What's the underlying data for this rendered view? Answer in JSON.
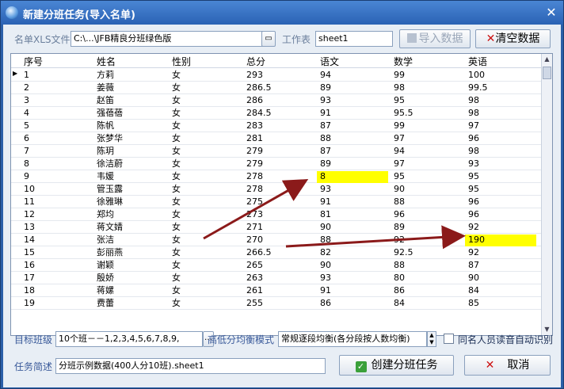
{
  "window": {
    "title": "新建分班任务(导入名单)"
  },
  "file": {
    "label": "名单XLS文件",
    "path": "C:\\...\\JFB精良分班绿色版",
    "sheet_label": "工作表",
    "sheet_value": "sheet1"
  },
  "buttons": {
    "import": "导入数据",
    "clear": "清空数据",
    "create": "创建分班任务",
    "cancel": "取消"
  },
  "table": {
    "headers": [
      "序号",
      "姓名",
      "性别",
      "总分",
      "语文",
      "数学",
      "英语"
    ],
    "rows": [
      [
        "1",
        "方莉",
        "女",
        "293",
        "94",
        "99",
        "100"
      ],
      [
        "2",
        "姜薇",
        "女",
        "286.5",
        "89",
        "98",
        "99.5"
      ],
      [
        "3",
        "赵笛",
        "女",
        "286",
        "93",
        "95",
        "98"
      ],
      [
        "4",
        "强蓓蓓",
        "女",
        "284.5",
        "91",
        "95.5",
        "98"
      ],
      [
        "5",
        "陈帆",
        "女",
        "283",
        "87",
        "99",
        "97"
      ],
      [
        "6",
        "张梦华",
        "女",
        "281",
        "88",
        "97",
        "96"
      ],
      [
        "7",
        "陈玥",
        "女",
        "279",
        "87",
        "94",
        "98"
      ],
      [
        "8",
        "徐洁蔚",
        "女",
        "279",
        "89",
        "97",
        "93"
      ],
      [
        "9",
        "韦媛",
        "女",
        "278",
        "8",
        "95",
        "95"
      ],
      [
        "10",
        "管玉露",
        "女",
        "278",
        "93",
        "90",
        "95"
      ],
      [
        "11",
        "徐雅琳",
        "女",
        "275",
        "91",
        "88",
        "96"
      ],
      [
        "12",
        "郑均",
        "女",
        "273",
        "81",
        "96",
        "96"
      ],
      [
        "13",
        "蒋文婧",
        "女",
        "271",
        "90",
        "89",
        "92"
      ],
      [
        "14",
        "张洁",
        "女",
        "270",
        "88",
        "92",
        "190"
      ],
      [
        "15",
        "彭丽燕",
        "女",
        "266.5",
        "82",
        "92.5",
        "92"
      ],
      [
        "16",
        "谢颖",
        "女",
        "265",
        "90",
        "88",
        "87"
      ],
      [
        "17",
        "殷娇",
        "女",
        "263",
        "93",
        "80",
        "90"
      ],
      [
        "18",
        "蒋嫘",
        "女",
        "261",
        "91",
        "86",
        "84"
      ],
      [
        "19",
        "费蕾",
        "女",
        "255",
        "86",
        "84",
        "85"
      ]
    ]
  },
  "bottom": {
    "target_label": "目标班级",
    "target_value": "10个班－－1,2,3,4,5,6,7,8,9,",
    "mode_label": "高低分均衡模式",
    "mode_value": "常规逐段均衡(各分段按人数均衡)",
    "checkbox_label": "同名人员读音自动识别",
    "desc_label": "任务简述",
    "desc_value": "分班示例数据(400人分10班).sheet1"
  },
  "colors": {
    "highlight": "#ffff00",
    "arrow": "#8b1a1a"
  }
}
